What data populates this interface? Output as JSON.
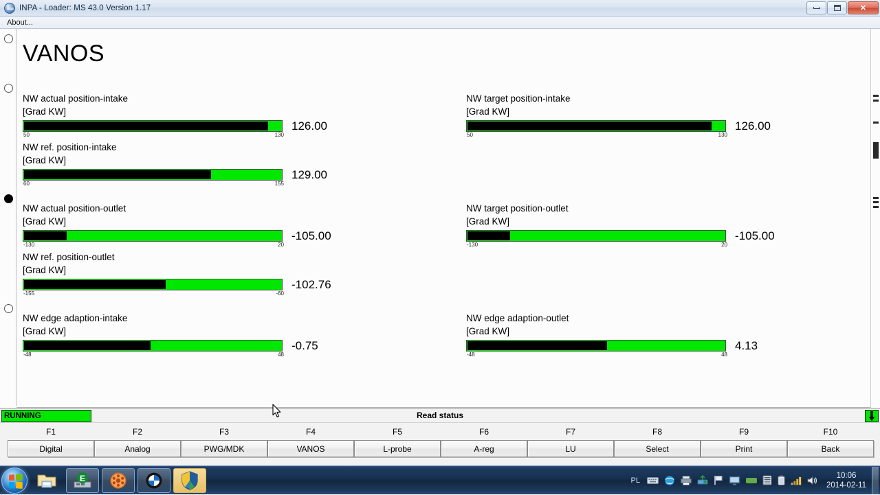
{
  "window": {
    "title": "INPA - Loader:  MS 43.0 Version 1.17",
    "menu_about": "About...",
    "minimize_label": "Minimize",
    "maximize_label": "Maximize",
    "close_label": "✕"
  },
  "page": {
    "title": "VANOS"
  },
  "gauges": [
    {
      "label": "NW actual position-intake",
      "unit": "[Grad KW]",
      "value": "126.00",
      "min": "50",
      "max": "130",
      "fill_pct": 95
    },
    {
      "label": "NW ref. position-intake",
      "unit": "[Grad KW]",
      "value": "129.00",
      "min": "60",
      "max": "155",
      "fill_pct": 72.6
    },
    {
      "label": "NW actual position-outlet",
      "unit": "[Grad KW]",
      "value": "-105.00",
      "min": "-130",
      "max": "20",
      "fill_pct": 16.7
    },
    {
      "label": "NW ref. position-outlet",
      "unit": "[Grad KW]",
      "value": "-102.76",
      "min": "-155",
      "max": "-60",
      "fill_pct": 55.0
    },
    {
      "label": "NW edge adaption-intake",
      "unit": "[Grad KW]",
      "value": "-0.75",
      "min": "-48",
      "max": "48",
      "fill_pct": 49.2
    },
    {
      "label": "NW target position-intake",
      "unit": "[Grad KW]",
      "value": "126.00",
      "min": "50",
      "max": "130",
      "fill_pct": 95
    },
    {
      "label": "NW target position-outlet",
      "unit": "[Grad KW]",
      "value": "-105.00",
      "min": "-130",
      "max": "20",
      "fill_pct": 16.7
    },
    {
      "label": "NW edge adaption-outlet",
      "unit": "[Grad KW]",
      "value": "4.13",
      "min": "-48",
      "max": "48",
      "fill_pct": 54.3
    }
  ],
  "statusbar": {
    "running_label": "RUNNING",
    "read_status": "Read status",
    "scroll_down_icon": "down-arrow",
    "running_color": "#00e800"
  },
  "function_keys": [
    {
      "key": "F1",
      "label": "Digital"
    },
    {
      "key": "F2",
      "label": "Analog"
    },
    {
      "key": "F3",
      "label": "PWG/MDK"
    },
    {
      "key": "F4",
      "label": "VANOS"
    },
    {
      "key": "F5",
      "label": "L-probe"
    },
    {
      "key": "F6",
      "label": "A-reg"
    },
    {
      "key": "F7",
      "label": "LU"
    },
    {
      "key": "F8",
      "label": "Select"
    },
    {
      "key": "F9",
      "label": "Print"
    },
    {
      "key": "F10",
      "label": "Back"
    }
  ],
  "taskbar": {
    "start_label": "Start",
    "items": [
      {
        "name": "windows-explorer-icon",
        "title": "Windows Explorer"
      },
      {
        "name": "ediabas-icon",
        "title": "EDIABAS"
      },
      {
        "name": "inpa-disc-icon",
        "title": "INPA"
      },
      {
        "name": "bmw-logo-icon",
        "title": "BMW Tool"
      },
      {
        "name": "shield-icon",
        "title": "INPA - Loader"
      }
    ],
    "tray": {
      "language": "PL",
      "icons": [
        "keyboard-icon",
        "network-globe-icon",
        "printer-icon",
        "safely-remove-icon",
        "flag-icon",
        "display-icon",
        "green-status-icon",
        "battery-list-icon",
        "battery-icon",
        "signal-icon",
        "volume-icon"
      ]
    },
    "clock": {
      "time": "10:06",
      "date": "2014-02-11"
    }
  }
}
